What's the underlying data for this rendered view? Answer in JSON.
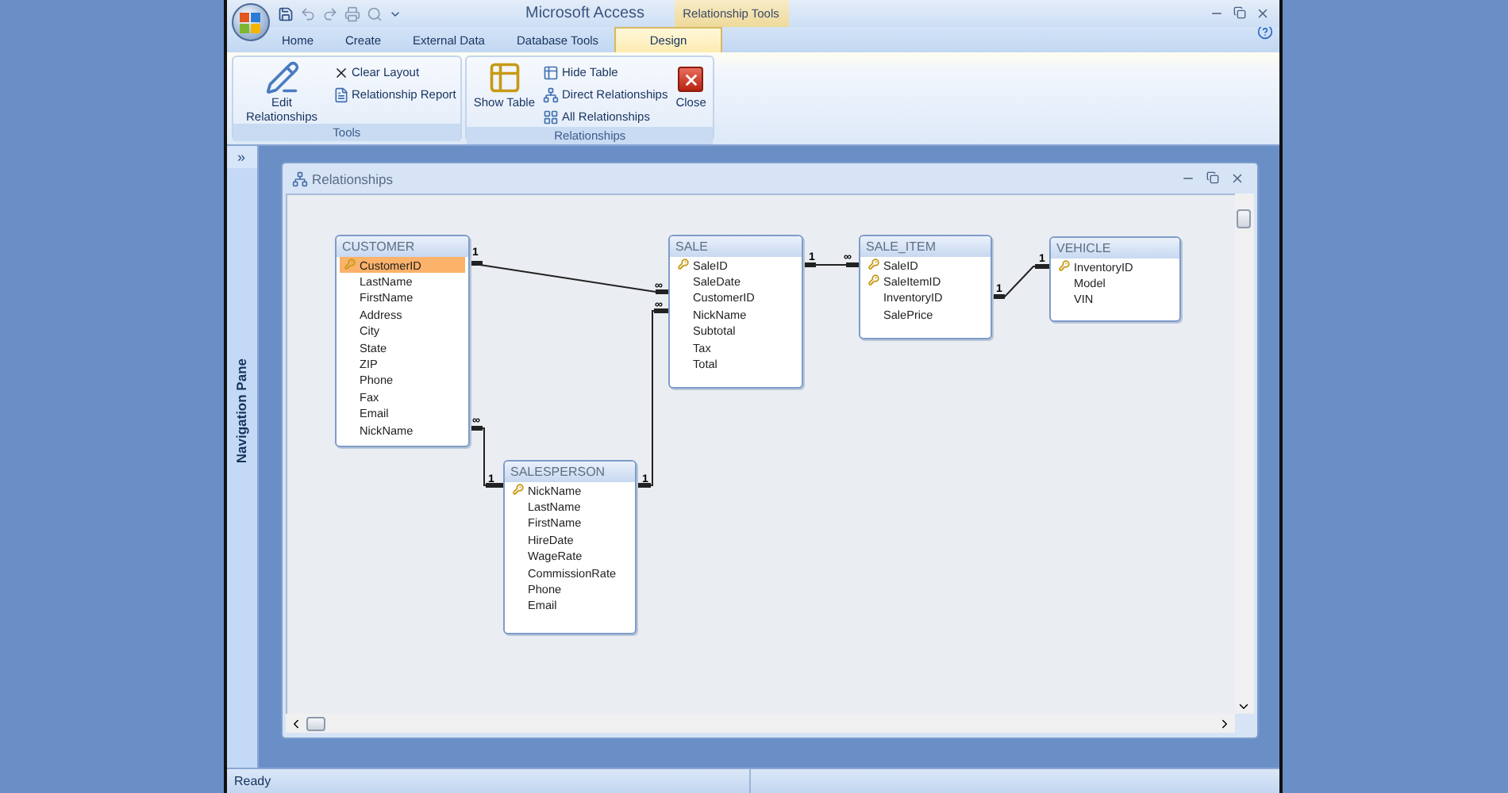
{
  "app": {
    "title": "Microsoft Access",
    "contextual_tab": "Relationship Tools"
  },
  "tabs": [
    {
      "label": "Home",
      "selected": false
    },
    {
      "label": "Create",
      "selected": false
    },
    {
      "label": "External Data",
      "selected": false
    },
    {
      "label": "Database Tools",
      "selected": false
    },
    {
      "label": "Design",
      "selected": true
    }
  ],
  "ribbon_groups": [
    {
      "label": "Tools",
      "buttons": [
        {
          "label": "Edit Relationships",
          "kind": "large"
        },
        {
          "label": "Clear Layout",
          "kind": "small"
        },
        {
          "label": "Relationship Report",
          "kind": "small"
        }
      ]
    },
    {
      "label": "Relationships",
      "buttons": [
        {
          "label": "Show Table",
          "kind": "large"
        },
        {
          "label": "Hide Table",
          "kind": "small"
        },
        {
          "label": "Direct Relationships",
          "kind": "small"
        },
        {
          "label": "All Relationships",
          "kind": "small"
        },
        {
          "label": "Close",
          "kind": "large"
        }
      ]
    }
  ],
  "navigation_pane": {
    "expand_glyph": "»",
    "label": "Navigation Pane"
  },
  "child_window": {
    "title": "Relationships"
  },
  "tables": [
    {
      "name": "CUSTOMER",
      "fields": [
        {
          "name": "CustomerID",
          "key": true,
          "selected": true
        },
        {
          "name": "LastName",
          "key": false,
          "selected": false
        },
        {
          "name": "FirstName",
          "key": false,
          "selected": false
        },
        {
          "name": "Address",
          "key": false,
          "selected": false
        },
        {
          "name": "City",
          "key": false,
          "selected": false
        },
        {
          "name": "State",
          "key": false,
          "selected": false
        },
        {
          "name": "ZIP",
          "key": false,
          "selected": false
        },
        {
          "name": "Phone",
          "key": false,
          "selected": false
        },
        {
          "name": "Fax",
          "key": false,
          "selected": false
        },
        {
          "name": "Email",
          "key": false,
          "selected": false
        },
        {
          "name": "NickName",
          "key": false,
          "selected": false
        }
      ]
    },
    {
      "name": "SALE",
      "fields": [
        {
          "name": "SaleID",
          "key": true,
          "selected": false
        },
        {
          "name": "SaleDate",
          "key": false,
          "selected": false
        },
        {
          "name": "CustomerID",
          "key": false,
          "selected": false
        },
        {
          "name": "NickName",
          "key": false,
          "selected": false
        },
        {
          "name": "Subtotal",
          "key": false,
          "selected": false
        },
        {
          "name": "Tax",
          "key": false,
          "selected": false
        },
        {
          "name": "Total",
          "key": false,
          "selected": false
        }
      ]
    },
    {
      "name": "SALE_ITEM",
      "fields": [
        {
          "name": "SaleID",
          "key": true,
          "selected": false
        },
        {
          "name": "SaleItemID",
          "key": true,
          "selected": false
        },
        {
          "name": "InventoryID",
          "key": false,
          "selected": false
        },
        {
          "name": "SalePrice",
          "key": false,
          "selected": false
        }
      ]
    },
    {
      "name": "VEHICLE",
      "fields": [
        {
          "name": "InventoryID",
          "key": true,
          "selected": false
        },
        {
          "name": "Model",
          "key": false,
          "selected": false
        },
        {
          "name": "VIN",
          "key": false,
          "selected": false
        }
      ]
    },
    {
      "name": "SALESPERSON",
      "fields": [
        {
          "name": "NickName",
          "key": true,
          "selected": false
        },
        {
          "name": "LastName",
          "key": false,
          "selected": false
        },
        {
          "name": "FirstName",
          "key": false,
          "selected": false
        },
        {
          "name": "HireDate",
          "key": false,
          "selected": false
        },
        {
          "name": "WageRate",
          "key": false,
          "selected": false
        },
        {
          "name": "CommissionRate",
          "key": false,
          "selected": false
        },
        {
          "name": "Phone",
          "key": false,
          "selected": false
        },
        {
          "name": "Email",
          "key": false,
          "selected": false
        }
      ]
    }
  ],
  "relationships": [
    {
      "from_end": "1",
      "to_end": "∞"
    },
    {
      "from_end": "∞",
      "to_end": "1"
    },
    {
      "from_end": "1",
      "to_end": "∞"
    },
    {
      "from_end": "1",
      "to_end": "∞"
    },
    {
      "from_end": "1",
      "to_end": "1"
    }
  ],
  "status_bar": {
    "text": "Ready"
  }
}
